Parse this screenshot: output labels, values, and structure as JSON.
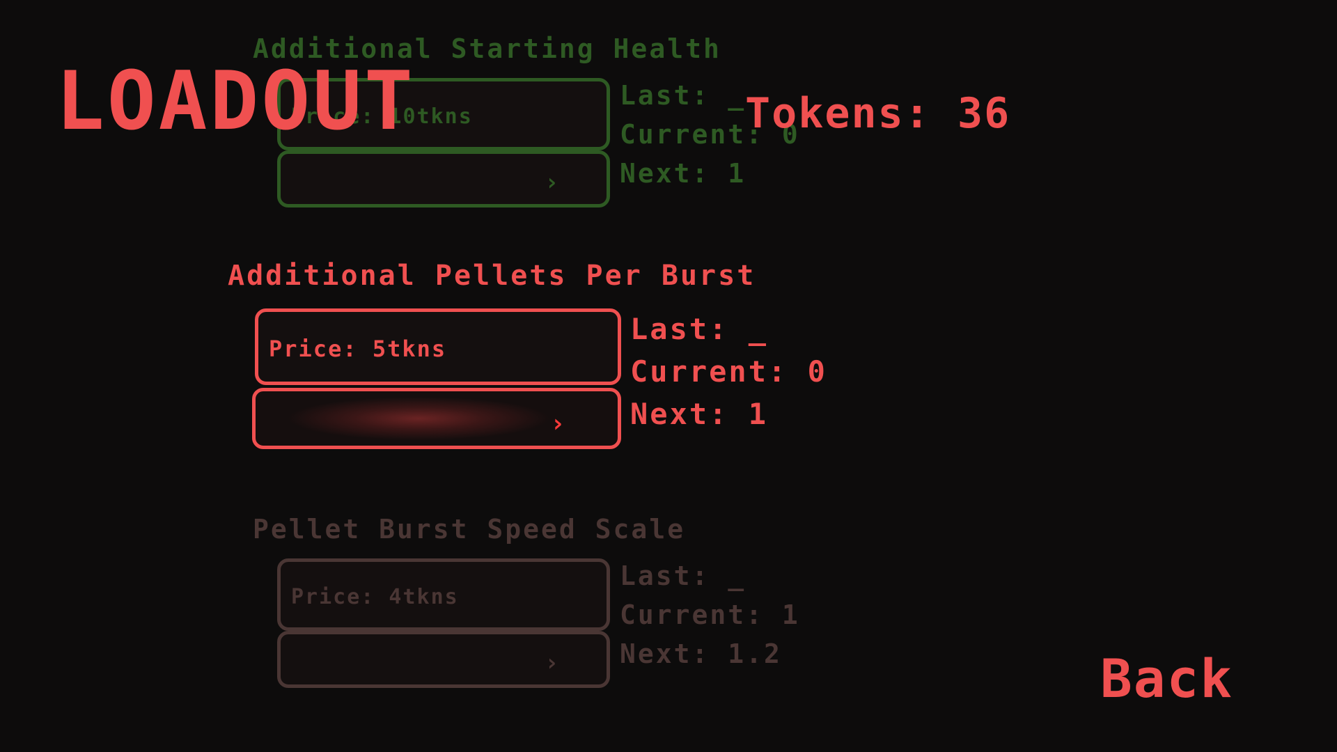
{
  "title": "LOADOUT",
  "tokens_label": "Tokens: 36",
  "back_label": "Back",
  "arrow_glyph": "›",
  "upgrades": [
    {
      "name": "Additional Starting Health",
      "price": "Price: 10tkns",
      "last": "Last: _",
      "current": "Current: 0",
      "next": "Next: 1",
      "state": "dim",
      "color": "#2e5a23"
    },
    {
      "name": "Additional Pellets Per Burst",
      "price": "Price: 5tkns",
      "last": "Last: _",
      "current": "Current: 0",
      "next": "Next: 1",
      "state": "selected",
      "color": "#f05050"
    },
    {
      "name": "Pellet Burst Speed Scale",
      "price": "Price: 4tkns",
      "last": "Last: _",
      "current": "Current: 1",
      "next": "Next: 1.2",
      "state": "dim",
      "color": "#4a3634"
    }
  ]
}
